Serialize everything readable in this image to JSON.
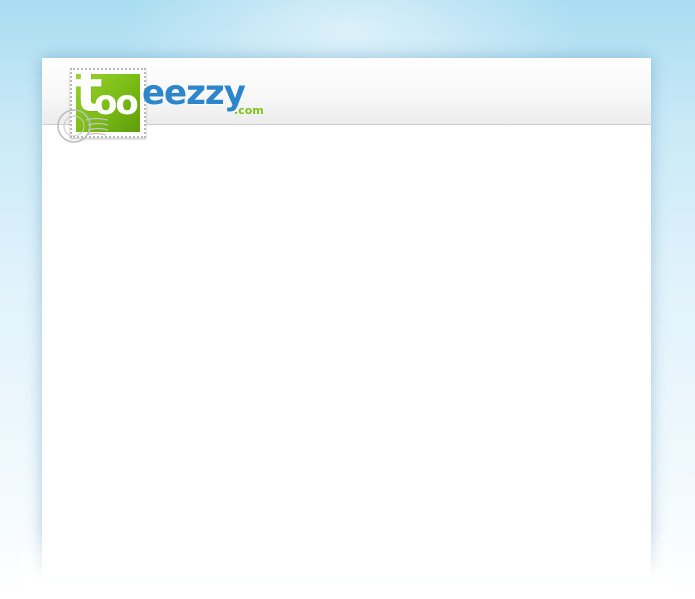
{
  "brand": {
    "stamp_letter": "t",
    "stamp_oo": "oo",
    "wordmark": "eezzy",
    "tld": ".com",
    "colors": {
      "stamp_green": "#79bb14",
      "wordmark_blue": "#2d86cc",
      "tld_green": "#7fc21a"
    }
  },
  "theme": {
    "background_top": "#a9dcf1",
    "background_bottom": "#ffffff",
    "card": "#ffffff"
  }
}
